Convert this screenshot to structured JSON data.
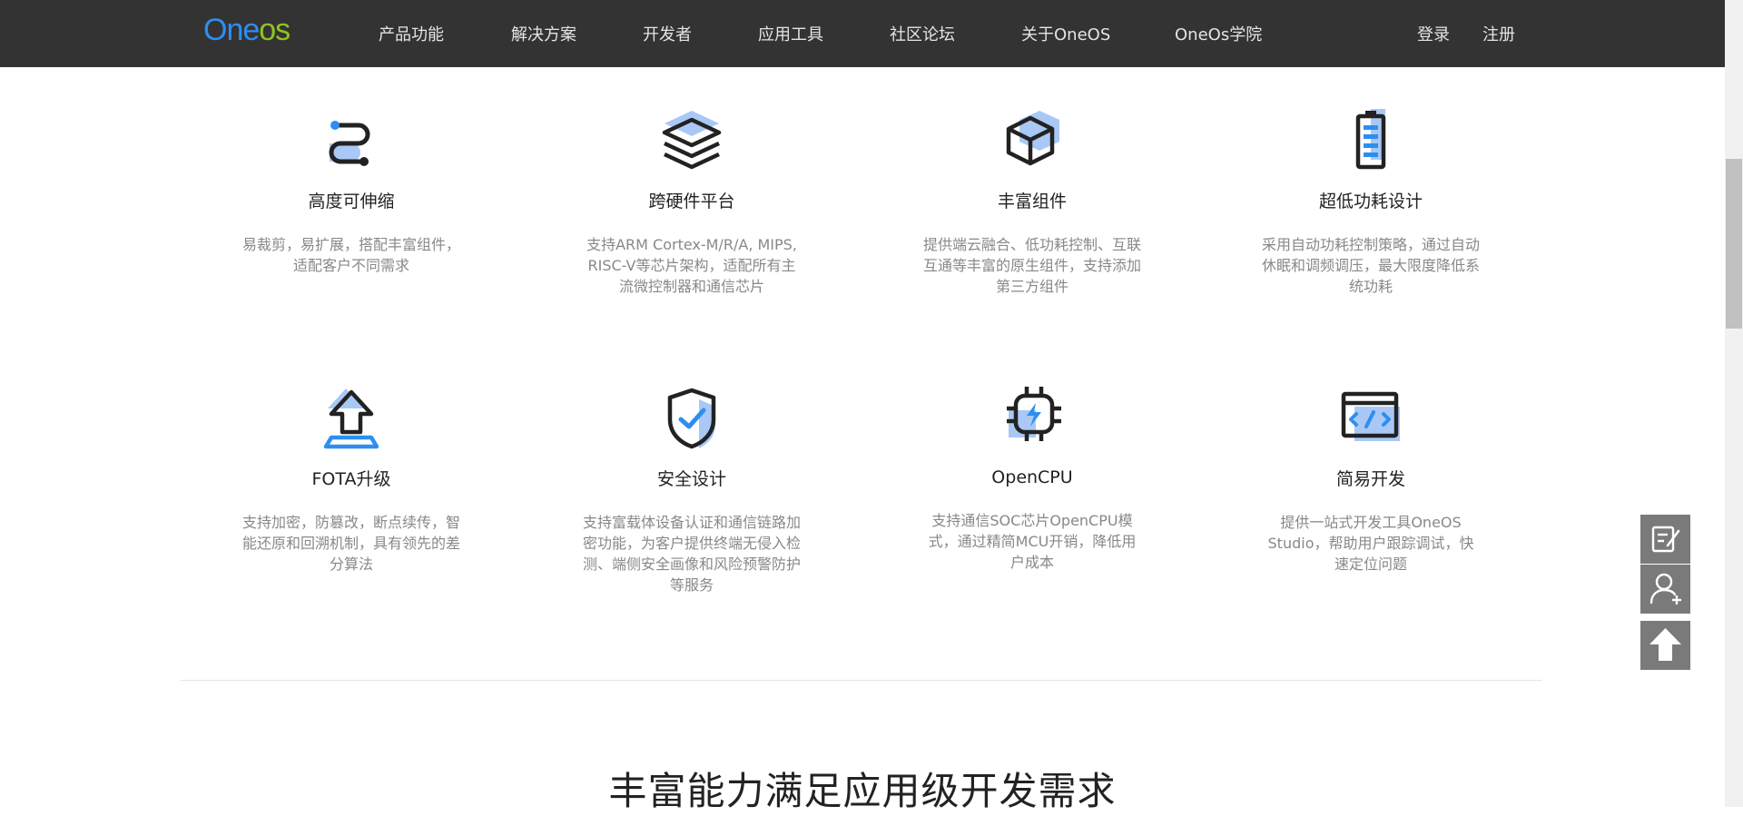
{
  "header": {
    "logo": {
      "part1": "One",
      "part2": "os"
    },
    "nav": [
      "产品功能",
      "解决方案",
      "开发者",
      "应用工具",
      "社区论坛",
      "关于OneOS",
      "OneOs学院"
    ],
    "login": "登录",
    "register": "注册"
  },
  "features": [
    {
      "icon": "scalable-icon",
      "title": "高度可伸缩",
      "desc": "易裁剪，易扩展，搭配丰富组件，适配客户不同需求"
    },
    {
      "icon": "layers-icon",
      "title": "跨硬件平台",
      "desc": "支持ARM Cortex-M/R/A, MIPS, RISC-V等芯片架构，适配所有主流微控制器和通信芯片"
    },
    {
      "icon": "cube-icon",
      "title": "丰富组件",
      "desc": "提供端云融合、低功耗控制、互联互通等丰富的原生组件，支持添加第三方组件"
    },
    {
      "icon": "battery-icon",
      "title": "超低功耗设计",
      "desc": "采用自动功耗控制策略，通过自动休眠和调频调压，最大限度降低系统功耗"
    },
    {
      "icon": "upload-arrow-icon",
      "title": "FOTA升级",
      "desc": "支持加密，防篡改，断点续传，智能还原和回溯机制，具有领先的差分算法"
    },
    {
      "icon": "shield-check-icon",
      "title": "安全设计",
      "desc": "支持富载体设备认证和通信链路加密功能，为客户提供终端无侵入检测、端侧安全画像和风险预警防护等服务"
    },
    {
      "icon": "chip-icon",
      "title": "OpenCPU",
      "desc": "支持通信SOC芯片OpenCPU模式，通过精简MCU开销，降低用户成本"
    },
    {
      "icon": "code-window-icon",
      "title": "简易开发",
      "desc": "提供一站式开发工具OneOS Studio，帮助用户跟踪调试，快速定位问题"
    }
  ],
  "section_heading": "丰富能力满足应用级开发需求",
  "float_buttons": [
    "feedback-icon",
    "add-user-icon",
    "back-to-top-icon"
  ],
  "colors": {
    "nav_bg": "#333333",
    "accent_blue": "#2e8ef0",
    "icon_light_blue": "#a9c8f5",
    "logo_green": "#8fc31f"
  }
}
